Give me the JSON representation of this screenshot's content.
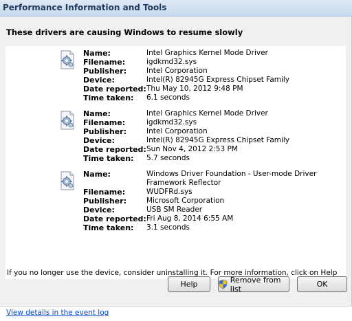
{
  "window": {
    "title": "Performance Information and Tools"
  },
  "heading": "These drivers are causing Windows to resume slowly",
  "labels": {
    "name": "Name:",
    "filename": "Filename:",
    "publisher": "Publisher:",
    "device": "Device:",
    "date_reported": "Date reported:",
    "time_taken": "Time taken:"
  },
  "drivers": [
    {
      "icon": "driver-gear-icon",
      "name": "Intel Graphics Kernel Mode Driver",
      "filename": "igdkmd32.sys",
      "publisher": "Intel Corporation",
      "device": "Intel(R) 82945G Express Chipset Family",
      "date_reported": "Thu May 10, 2012 9:48 PM",
      "time_taken": "6.1 seconds"
    },
    {
      "icon": "driver-gear-icon",
      "name": "Intel Graphics Kernel Mode Driver",
      "filename": "igdkmd32.sys",
      "publisher": "Intel Corporation",
      "device": "Intel(R) 82945G Express Chipset Family",
      "date_reported": "Sun Nov 4, 2012 2:53 PM",
      "time_taken": "5.7 seconds"
    },
    {
      "icon": "driver-gear-icon",
      "name": "Windows Driver Foundation - User-mode Driver Framework Reflector",
      "filename": "WUDFRd.sys",
      "publisher": "Microsoft Corporation",
      "device": "USB SM Reader",
      "date_reported": "Fri Aug 8, 2014 6:55 AM",
      "time_taken": "3.1 seconds"
    }
  ],
  "hint": "If you no longer use the device, consider uninstalling it. For more information, click on Help",
  "buttons": {
    "help": "Help",
    "remove": "Remove from list",
    "ok": "OK"
  },
  "footer_link": "View details in the event log",
  "colors": {
    "link": "#0046c6",
    "title_text": "#1e395b"
  }
}
